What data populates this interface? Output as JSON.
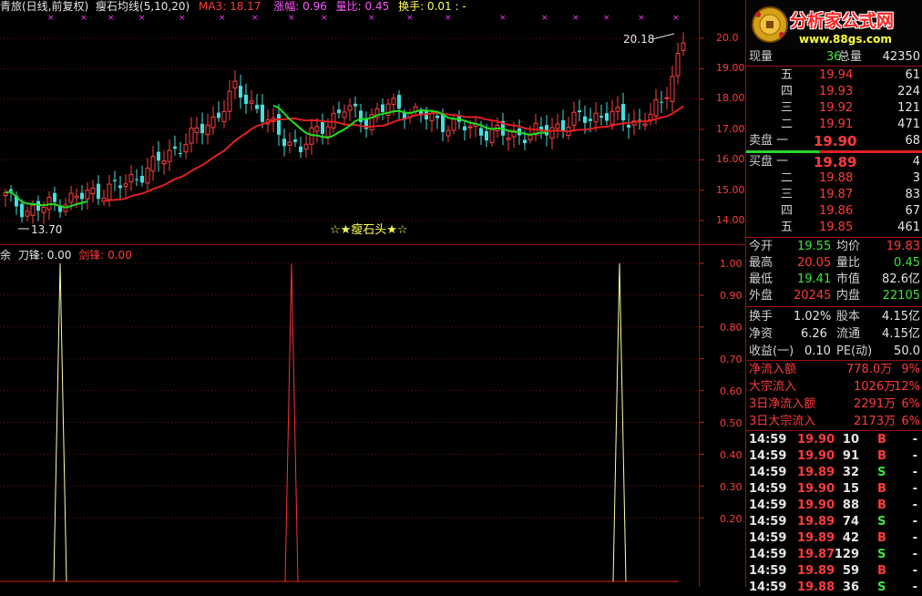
{
  "header": {
    "name": "青旅(日线,前复权)",
    "indicator": "瘦石均线(5,10,20)",
    "ma3": "MA3: 18.17",
    "change": "涨幅: 0.96",
    "volume_ratio": "量比: 0.45",
    "turnover": "换手: 0.01 : -"
  },
  "logo": {
    "title": "分析家公式网",
    "url": "www.88gs.com"
  },
  "main_chart": {
    "price_ticks": [
      "20.0",
      "19.00",
      "18.00",
      "17.00",
      "16.00",
      "15.00",
      "14.00"
    ],
    "high_label": "20.18",
    "low_label": "13.70",
    "signal_label": "☆★瘦石头★☆"
  },
  "sub_chart": {
    "legend_a": "余",
    "legend_b": "刀锋: 0.00",
    "legend_c": "剑锋: 0.00",
    "ticks": [
      "1.00",
      "0.90",
      "0.80",
      "0.70",
      "0.60",
      "0.50",
      "0.40",
      "0.30",
      "0.20"
    ]
  },
  "chart_data": {
    "type": "candlestick",
    "price_axis": {
      "min": 13.7,
      "max": 20.18
    },
    "sub_series": {
      "name": "",
      "spikes": [
        {
          "value": 1.0,
          "color": "#ffffa0"
        },
        {
          "value": 1.0,
          "color": "#ff3030"
        },
        {
          "value": 1.0,
          "color": "#ffffa0"
        }
      ]
    }
  },
  "quote": {
    "current_label": "现量",
    "current_val": "36",
    "total_label": "总量",
    "total_val": "42350",
    "asks": [
      {
        "label": "五",
        "price": "19.94",
        "vol": "61"
      },
      {
        "label": "四",
        "price": "19.93",
        "vol": "224"
      },
      {
        "label": "三",
        "price": "19.92",
        "vol": "121"
      },
      {
        "label": "二",
        "price": "19.91",
        "vol": "471"
      },
      {
        "label": "卖盘 一",
        "price": "19.90",
        "vol": "68"
      }
    ],
    "bids": [
      {
        "label": "买盘 一",
        "price": "19.89",
        "vol": "4"
      },
      {
        "label": "二",
        "price": "19.88",
        "vol": "3"
      },
      {
        "label": "三",
        "price": "19.87",
        "vol": "83"
      },
      {
        "label": "四",
        "price": "19.86",
        "vol": "67"
      },
      {
        "label": "五",
        "price": "19.85",
        "vol": "461"
      }
    ],
    "stats": [
      {
        "l1": "今开",
        "v1": "19.55",
        "c1": "grn",
        "l2": "均价",
        "v2": "19.83",
        "c2": "red"
      },
      {
        "l1": "最高",
        "v1": "20.05",
        "c1": "red",
        "l2": "量比",
        "v2": "0.45",
        "c2": "grn"
      },
      {
        "l1": "最低",
        "v1": "19.41",
        "c1": "grn",
        "l2": "市值",
        "v2": "82.6亿",
        "c2": "wht"
      },
      {
        "l1": "外盘",
        "v1": "20245",
        "c1": "red",
        "l2": "内盘",
        "v2": "22105",
        "c2": "grn"
      }
    ],
    "stats2": [
      {
        "l1": "换手",
        "v1": "1.02%",
        "l2": "股本",
        "v2": "4.15亿"
      },
      {
        "l1": "净资",
        "v1": "6.26",
        "l2": "流通",
        "v2": "4.15亿"
      },
      {
        "l1": "收益(一)",
        "v1": "0.10",
        "l2": "PE(动)",
        "v2": "50.0"
      }
    ],
    "flows": [
      {
        "label": "净流入额",
        "val": "778.0万",
        "pct": "9%"
      },
      {
        "label": "大宗流入",
        "val": "1026万",
        "pct": "12%"
      },
      {
        "label": "3日净流入额",
        "val": "2291万",
        "pct": "6%"
      },
      {
        "label": "3日大宗流入",
        "val": "2173万",
        "pct": "6%"
      }
    ],
    "ticks": [
      {
        "time": "14:59",
        "price": "19.90",
        "vol": "10",
        "side": "B",
        "pc": "red",
        "sc": "red"
      },
      {
        "time": "14:59",
        "price": "19.90",
        "vol": "91",
        "side": "B",
        "pc": "red",
        "sc": "red"
      },
      {
        "time": "14:59",
        "price": "19.89",
        "vol": "32",
        "side": "S",
        "pc": "red",
        "sc": "grn"
      },
      {
        "time": "14:59",
        "price": "19.90",
        "vol": "15",
        "side": "B",
        "pc": "red",
        "sc": "red"
      },
      {
        "time": "14:59",
        "price": "19.90",
        "vol": "88",
        "side": "B",
        "pc": "red",
        "sc": "red"
      },
      {
        "time": "14:59",
        "price": "19.89",
        "vol": "74",
        "side": "S",
        "pc": "red",
        "sc": "grn"
      },
      {
        "time": "14:59",
        "price": "19.89",
        "vol": "42",
        "side": "B",
        "pc": "red",
        "sc": "red"
      },
      {
        "time": "14:59",
        "price": "19.87",
        "vol": "129",
        "side": "S",
        "pc": "red",
        "sc": "grn"
      },
      {
        "time": "14:59",
        "price": "19.89",
        "vol": "59",
        "side": "B",
        "pc": "red",
        "sc": "red"
      },
      {
        "time": "14:59",
        "price": "19.88",
        "vol": "36",
        "side": "S",
        "pc": "red",
        "sc": "grn"
      }
    ],
    "tick_dash": "-"
  }
}
